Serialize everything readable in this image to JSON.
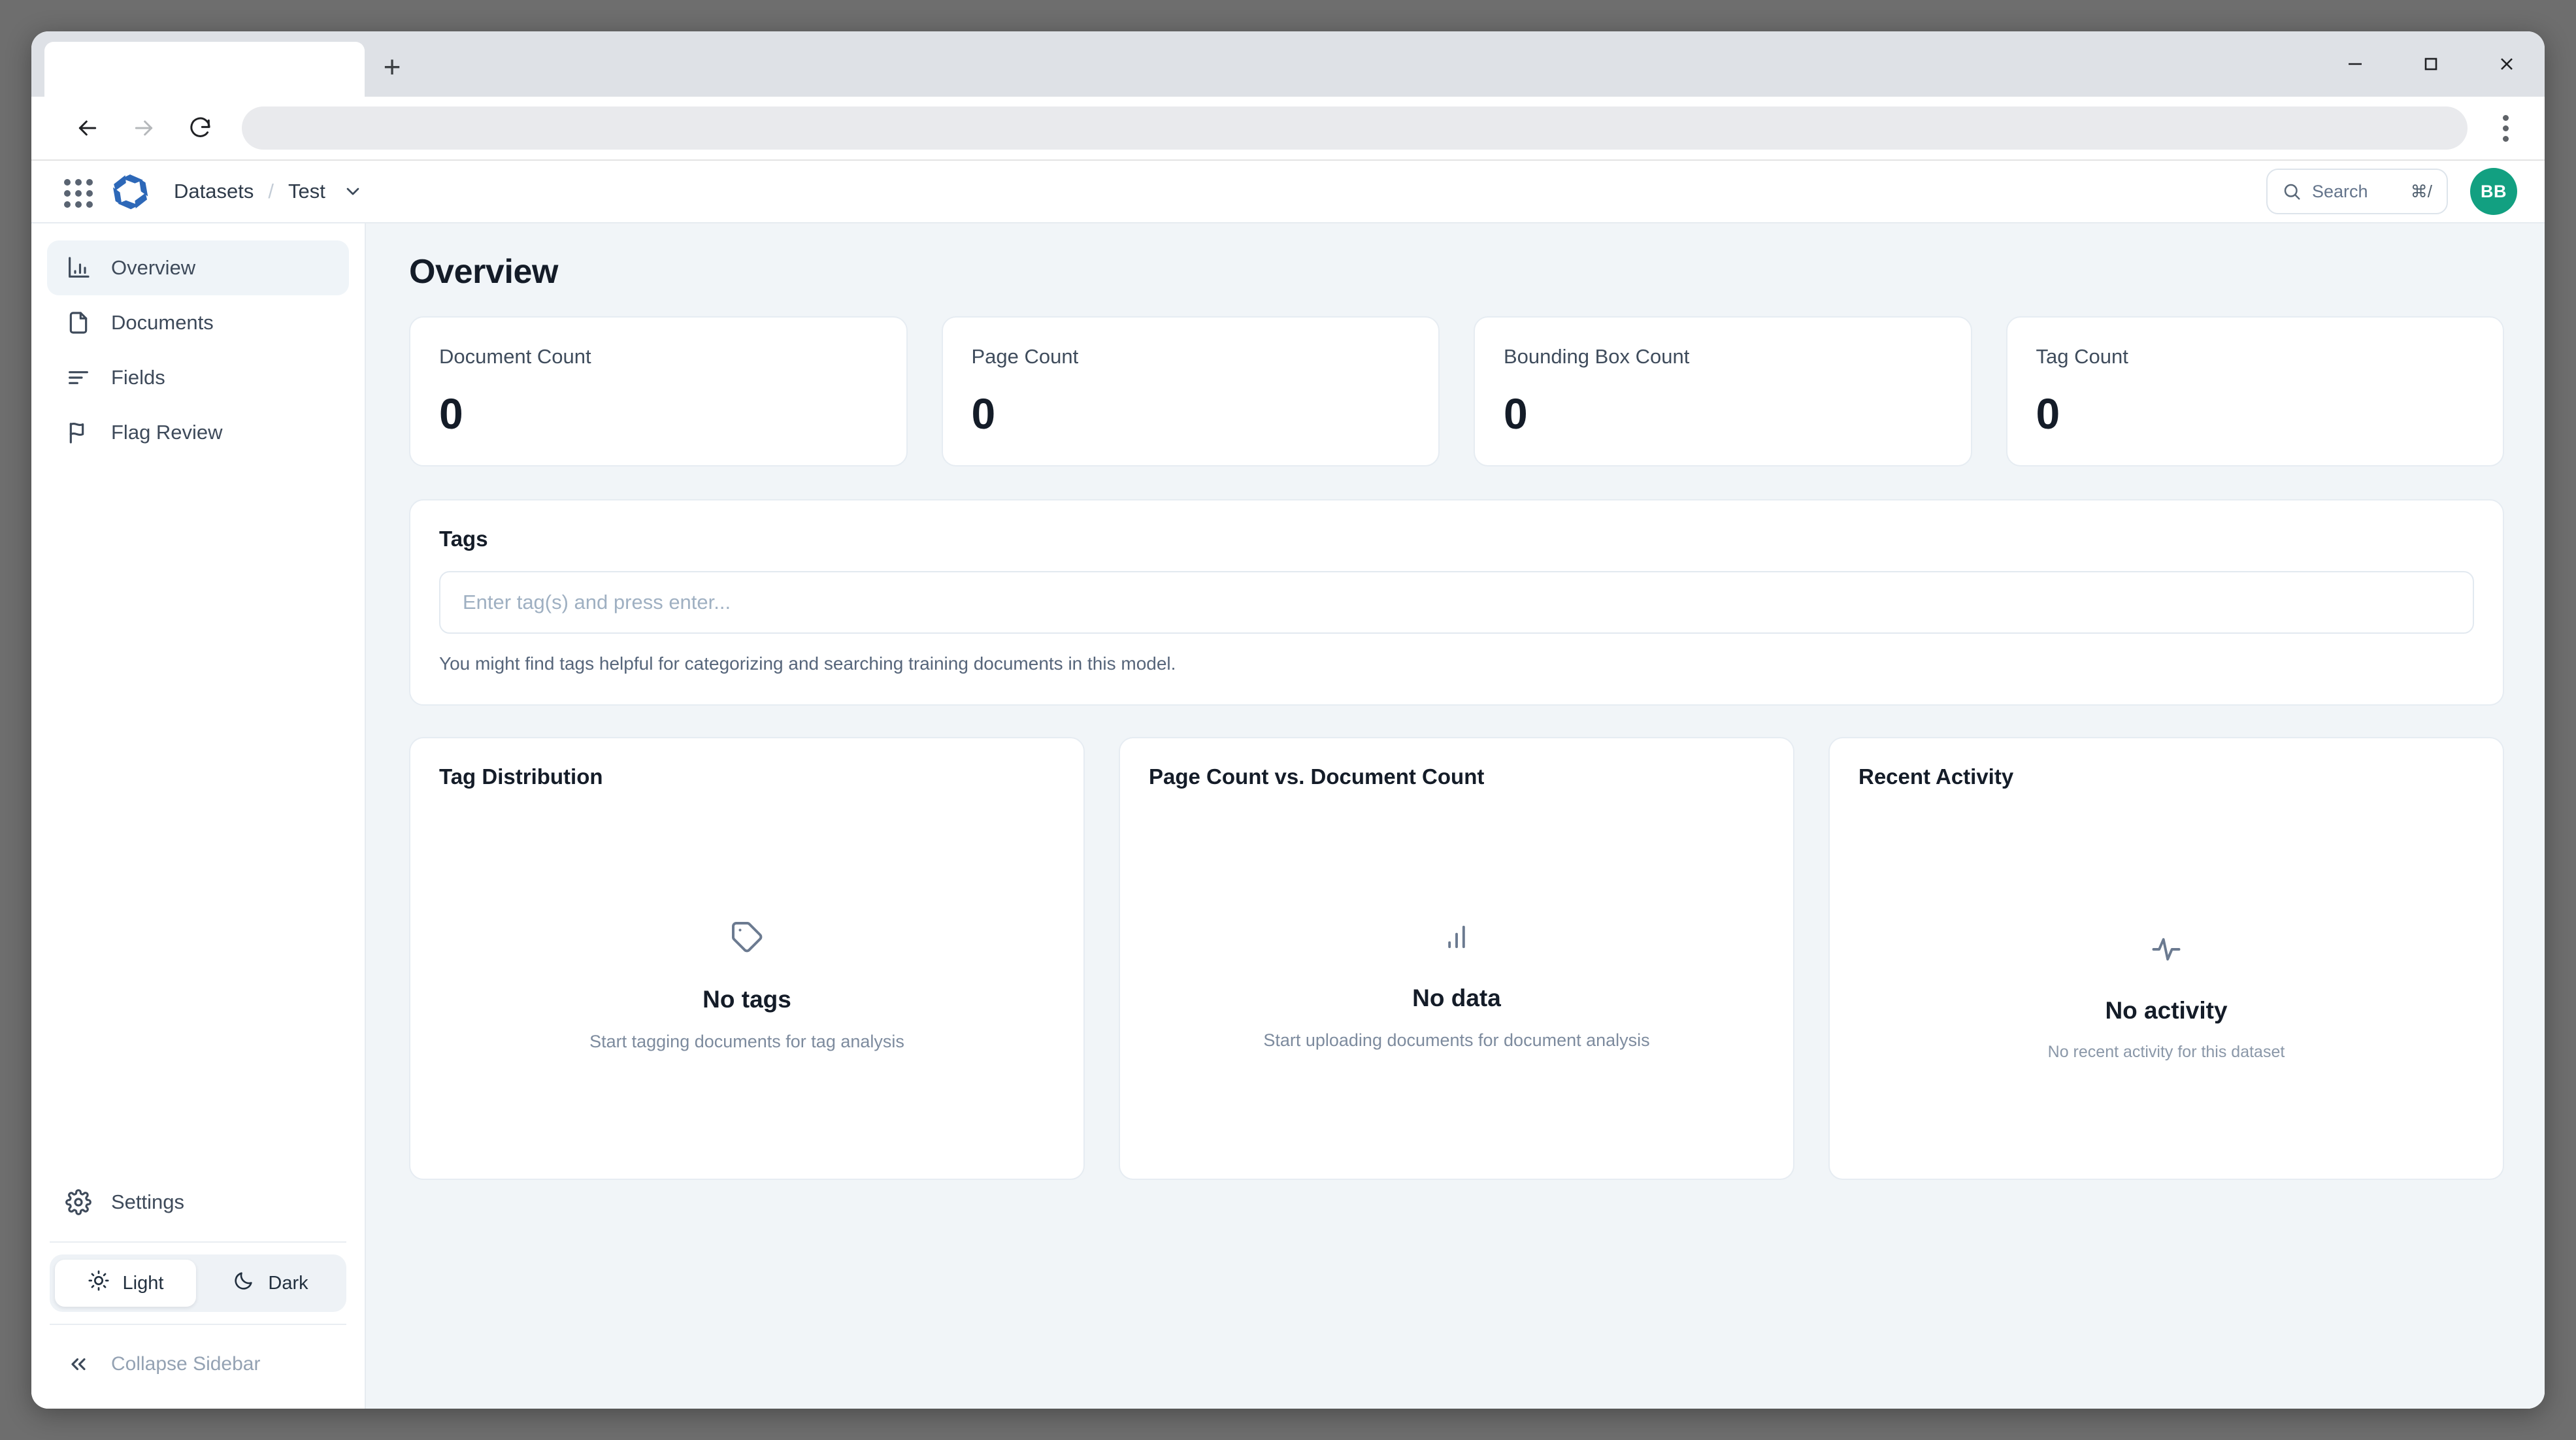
{
  "browser": {
    "tab_title": "",
    "new_tab_label": "+",
    "url": "",
    "controls": {
      "minimize": "minimize-icon",
      "maximize": "maximize-icon",
      "close": "close-icon",
      "back": "back-arrow-icon",
      "forward": "forward-arrow-icon",
      "reload": "reload-icon",
      "menu": "kebab-menu-icon"
    }
  },
  "header": {
    "apps_icon": "grid-apps-icon",
    "logo": "aperture-logo-icon",
    "logo_color": "#2d68b8",
    "breadcrumb": {
      "root": "Datasets",
      "separator": "/",
      "current": "Test",
      "caret": "chevron-down-icon"
    },
    "search": {
      "icon": "search-icon",
      "placeholder": "Search",
      "shortcut": "⌘/"
    },
    "avatar": {
      "initials": "BB",
      "color": "#12a081"
    }
  },
  "sidebar": {
    "items": [
      {
        "label": "Overview",
        "icon": "bar-chart-icon",
        "active": true
      },
      {
        "label": "Documents",
        "icon": "document-icon",
        "active": false
      },
      {
        "label": "Fields",
        "icon": "list-lines-icon",
        "active": false
      },
      {
        "label": "Flag Review",
        "icon": "flag-icon",
        "active": false
      }
    ],
    "settings": {
      "label": "Settings",
      "icon": "gear-icon"
    },
    "theme": {
      "light": {
        "label": "Light",
        "icon": "sun-icon",
        "selected": true
      },
      "dark": {
        "label": "Dark",
        "icon": "moon-icon",
        "selected": false
      }
    },
    "collapse": {
      "label": "Collapse Sidebar",
      "icon": "chevrons-left-icon"
    }
  },
  "main": {
    "title": "Overview",
    "stats": [
      {
        "label": "Document Count",
        "value": "0"
      },
      {
        "label": "Page Count",
        "value": "0"
      },
      {
        "label": "Bounding Box Count",
        "value": "0"
      },
      {
        "label": "Tag Count",
        "value": "0"
      }
    ],
    "tags": {
      "title": "Tags",
      "placeholder": "Enter tag(s) and press enter...",
      "value": "",
      "help": "You might find tags helpful for categorizing and searching training documents in this model."
    },
    "cards": [
      {
        "title": "Tag Distribution",
        "icon": "tag-icon",
        "empty_title": "No tags",
        "empty_sub": "Start tagging documents for tag analysis"
      },
      {
        "title": "Page Count vs. Document Count",
        "icon": "bar-chart-icon",
        "empty_title": "No data",
        "empty_sub": "Start uploading documents for document analysis"
      },
      {
        "title": "Recent Activity",
        "icon": "activity-pulse-icon",
        "empty_title": "No activity",
        "empty_sub": "No recent activity for this dataset"
      }
    ]
  },
  "chart_data": [
    {
      "type": "pie",
      "title": "Tag Distribution",
      "categories": [],
      "values": [],
      "state": "empty"
    },
    {
      "type": "bar",
      "title": "Page Count vs. Document Count",
      "categories": [],
      "values": [],
      "xlabel": "",
      "ylabel": "",
      "state": "empty"
    },
    {
      "type": "line",
      "title": "Recent Activity",
      "x": [],
      "values": [],
      "state": "empty"
    }
  ]
}
